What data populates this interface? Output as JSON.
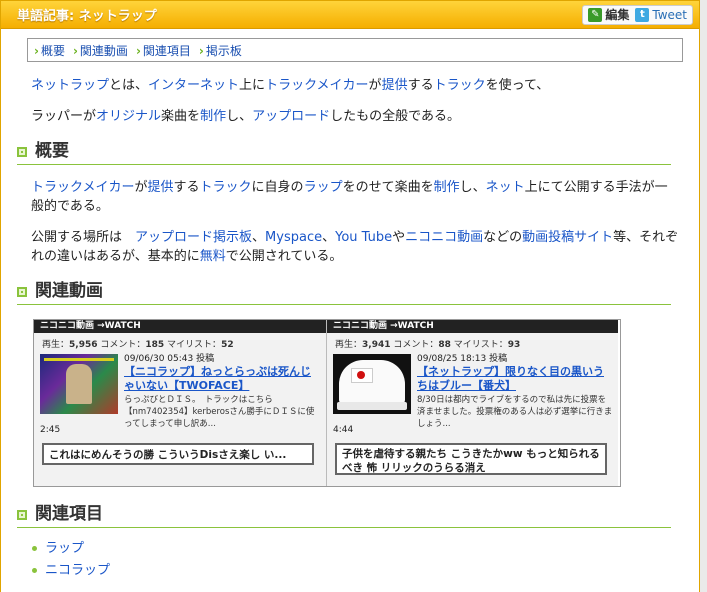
{
  "header": {
    "title": "単語記事: ネットラップ",
    "edit_label": "編集",
    "tweet_label": "Tweet"
  },
  "toc": [
    "概要",
    "関連動画",
    "関連項目",
    "掲示板"
  ],
  "intro": {
    "line1": [
      {
        "t": "ネットラップ",
        "link": true
      },
      {
        "t": "とは、",
        "link": false
      },
      {
        "t": "インターネット",
        "link": true
      },
      {
        "t": "上に",
        "link": false
      },
      {
        "t": "トラックメイカー",
        "link": true
      },
      {
        "t": "が",
        "link": false
      },
      {
        "t": "提供",
        "link": true
      },
      {
        "t": "する",
        "link": false
      },
      {
        "t": "トラック",
        "link": true
      },
      {
        "t": "を使って、",
        "link": false
      }
    ],
    "line2": [
      {
        "t": "ラッパー",
        "link": false
      },
      {
        "t": "が",
        "link": false
      },
      {
        "t": "オリジナル",
        "link": true
      },
      {
        "t": "楽曲を",
        "link": false
      },
      {
        "t": "制作",
        "link": true
      },
      {
        "t": "し、",
        "link": false
      },
      {
        "t": "アップロード",
        "link": true
      },
      {
        "t": "したもの全般である。",
        "link": false
      }
    ]
  },
  "sections": {
    "overview": {
      "heading": "概要",
      "para1": [
        {
          "t": "トラックメイカー",
          "link": true
        },
        {
          "t": "が",
          "link": false
        },
        {
          "t": "提供",
          "link": true
        },
        {
          "t": "する",
          "link": false
        },
        {
          "t": "トラック",
          "link": true
        },
        {
          "t": "に自身の",
          "link": false
        },
        {
          "t": "ラップ",
          "link": true
        },
        {
          "t": "をのせて楽曲を",
          "link": false
        },
        {
          "t": "制作",
          "link": true
        },
        {
          "t": "し、",
          "link": false
        },
        {
          "t": "ネット",
          "link": true
        },
        {
          "t": "上にて公開する手法が一般的である。",
          "link": false
        }
      ],
      "para2": [
        {
          "t": "公開する場所は　",
          "link": false
        },
        {
          "t": "アップロード掲示板",
          "link": true
        },
        {
          "t": "、",
          "link": false
        },
        {
          "t": "Myspace",
          "link": true
        },
        {
          "t": "、",
          "link": false
        },
        {
          "t": "You Tube",
          "link": true
        },
        {
          "t": "や",
          "link": false
        },
        {
          "t": "ニコニコ動画",
          "link": true
        },
        {
          "t": "などの",
          "link": false
        },
        {
          "t": "動画投稿サイト",
          "link": true
        },
        {
          "t": "等、それぞれの違いはあるが、基本的に",
          "link": false
        },
        {
          "t": "無料",
          "link": true
        },
        {
          "t": "で公開されている。",
          "link": false
        }
      ]
    },
    "videos": {
      "heading": "関連動画",
      "items": [
        {
          "bar": "ニコニコ動画 →WATCH",
          "play_label": "再生：",
          "plays": "5,956",
          "comment_label": "コメント：",
          "comments": "185",
          "mylist_label": "マイリスト：",
          "mylists": "52",
          "date": "09/06/30 05:43",
          "post_label": "投稿",
          "title": "【ニコラップ】ねっとらっぷは死んじゃいない【TWOFACE】",
          "desc": "らっぷびとＤＩＳ。　トラックはこちら【nm7402354】kerberosさん勝手にＤＩＳに使ってしまって申し訳あ...",
          "length": "2:45",
          "comment": "これはにめんそうの勝 こういうDisさえ楽し い..."
        },
        {
          "bar": "ニコニコ動画 →WATCH",
          "play_label": "再生：",
          "plays": "3,941",
          "comment_label": "コメント：",
          "comments": "88",
          "mylist_label": "マイリスト：",
          "mylists": "93",
          "date": "09/08/25 18:13",
          "post_label": "投稿",
          "title": "【ネットラップ】限りなく目の黒いうちはブルー【番犬】",
          "desc": "8/30日は都内でライブをするので私は先に投票を済ませました。投票権のある人は必ず選挙に行きましょう...",
          "length": "4:44",
          "comment": "子供を虐待する親たち こうきたかww もっと知られるべき 怖 リリックのうらる消え"
        }
      ]
    },
    "related": {
      "heading": "関連項目",
      "items": [
        "ラップ",
        "ニコラップ"
      ]
    }
  }
}
